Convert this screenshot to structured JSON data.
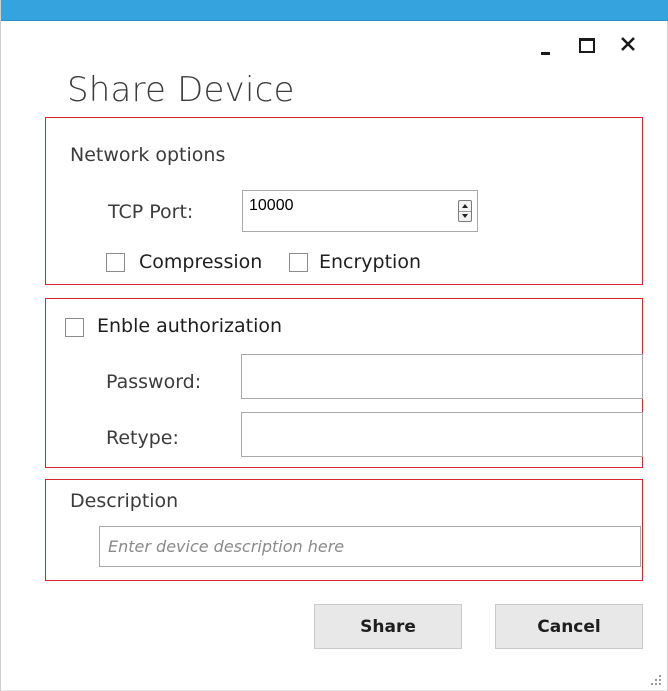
{
  "window": {
    "title": "Share Device",
    "controls": {
      "minimize_icon": "minimize-icon",
      "maximize_icon": "maximize-icon",
      "close_icon": "close-icon"
    },
    "accent_color": "#35a3dd"
  },
  "network_options": {
    "title": "Network options",
    "tcp_port_label": "TCP Port:",
    "tcp_port_value": "10000",
    "compression_label": "Compression",
    "compression_checked": false,
    "encryption_label": "Encryption",
    "encryption_checked": false
  },
  "authorization": {
    "enable_label": "Enble authorization",
    "enable_checked": false,
    "password_label": "Password:",
    "password_value": "",
    "retype_label": "Retype:",
    "retype_value": ""
  },
  "description": {
    "title": "Description",
    "placeholder": "Enter device description here",
    "value": ""
  },
  "buttons": {
    "share_label": "Share",
    "cancel_label": "Cancel"
  },
  "highlight_color": "#d4272d"
}
